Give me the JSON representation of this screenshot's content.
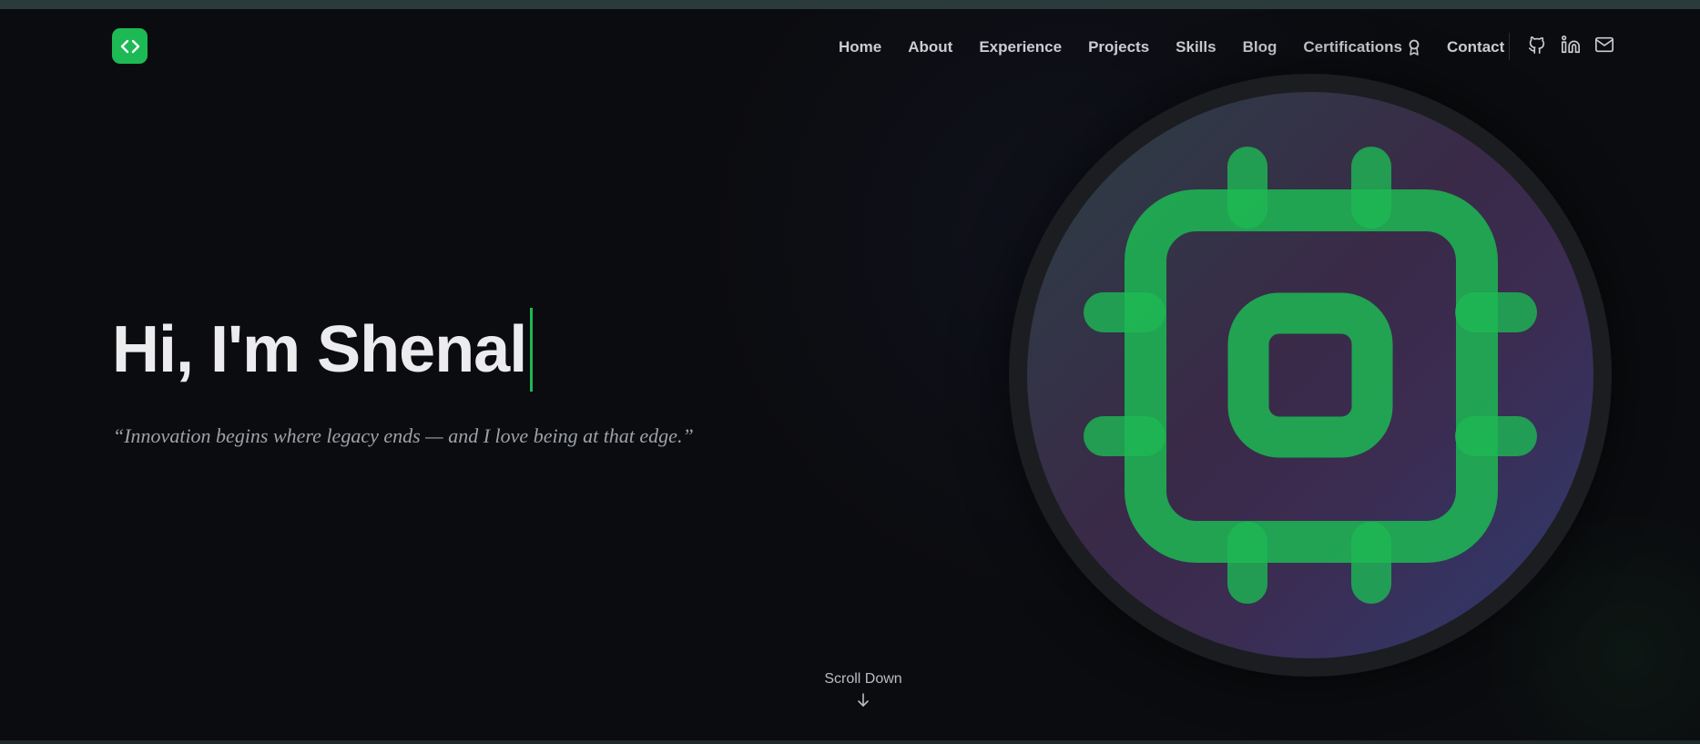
{
  "colors": {
    "accent": "#1db954",
    "background": "#0b0c0f",
    "nav_text": "#c9cdd2"
  },
  "logo": {
    "icon": "code-brackets-icon"
  },
  "nav": {
    "items": [
      {
        "label": "Home"
      },
      {
        "label": "About"
      },
      {
        "label": "Experience"
      },
      {
        "label": "Projects"
      },
      {
        "label": "Skills"
      },
      {
        "label": "Blog"
      },
      {
        "label": "Certifications",
        "icon": "award-icon"
      },
      {
        "label": "Contact"
      }
    ]
  },
  "social": [
    {
      "name": "github-icon"
    },
    {
      "name": "linkedin-icon"
    },
    {
      "name": "mail-icon"
    }
  ],
  "hero": {
    "headline": "Hi, I'm Shenal",
    "quote": "“Innovation begins where legacy ends — and I love being at that edge.”",
    "illustration": "cpu-chip-icon"
  },
  "scroll": {
    "label": "Scroll Down",
    "icon": "arrow-down-icon"
  }
}
